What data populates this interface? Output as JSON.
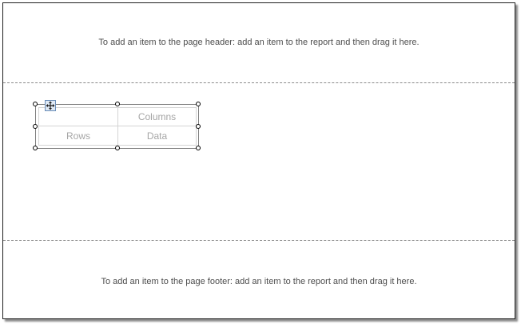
{
  "page_header": {
    "hint": "To add an item to the page header: add an item to the report and then drag it here."
  },
  "page_footer": {
    "hint": "To add an item to the page footer: add an item to the report and then drag it here."
  },
  "matrix": {
    "columns_label": "Columns",
    "rows_label": "Rows",
    "data_label": "Data",
    "move_icon": "move-icon"
  },
  "colors": {
    "page_border": "#202020",
    "section_divider": "#8a8a8a",
    "placeholder_text": "#a6a6a6"
  }
}
